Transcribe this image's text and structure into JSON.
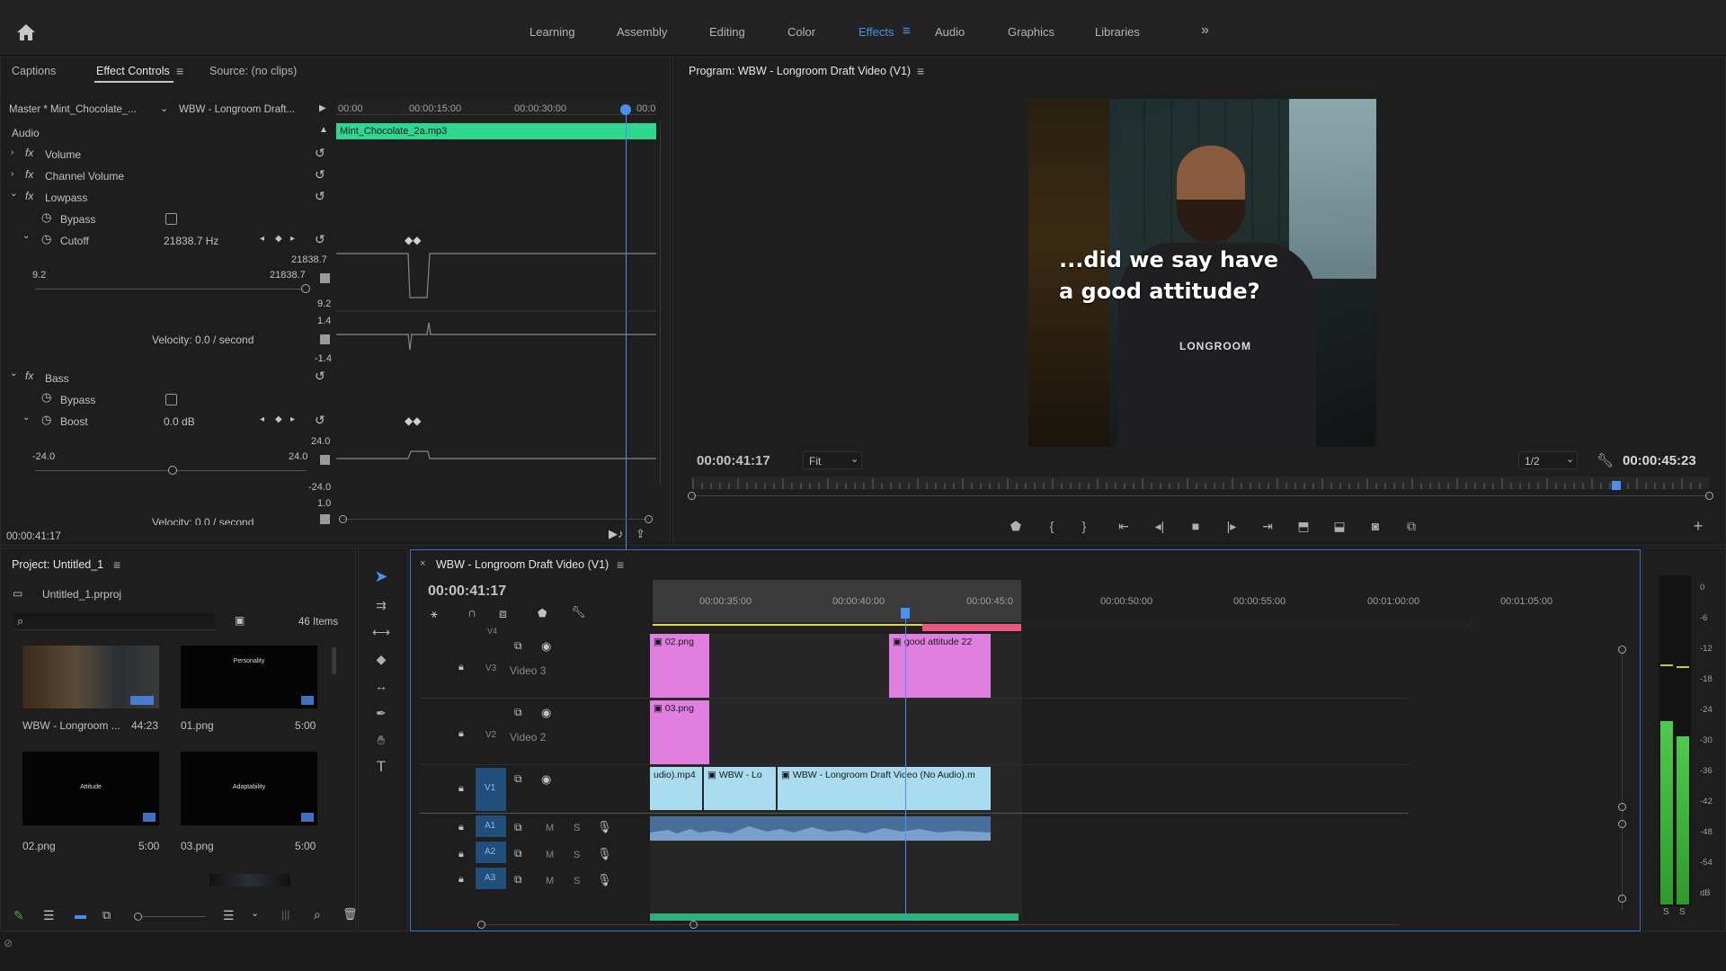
{
  "workspaces": {
    "items": [
      "Learning",
      "Assembly",
      "Editing",
      "Color",
      "Effects",
      "Audio",
      "Graphics",
      "Libraries"
    ],
    "active": "Effects",
    "more": "»"
  },
  "effect_panel": {
    "tabs": [
      "Captions",
      "Effect Controls",
      "Source: (no clips)"
    ],
    "master": "Master * Mint_Chocolate_...",
    "sequence": "WBW - Longroom Draft...",
    "ruler": [
      "00:00",
      "00:00:15:00",
      "00:00:30:00",
      "00:0"
    ],
    "clip_name": "Mint_Chocolate_2a.mp3",
    "section": "Audio",
    "volume": "Volume",
    "channel_volume": "Channel Volume",
    "lowpass": "Lowpass",
    "bypass": "Bypass",
    "cutoff": "Cutoff",
    "cutoff_value": "21838.7 Hz",
    "cutoff_max": "21838.7",
    "cutoff_min_left": "9.2",
    "cutoff_max_right": "21838.7",
    "cutoff_min": "9.2",
    "vel_top": "1.4",
    "velocity": "Velocity: 0.0 / second",
    "vel_bottom": "-1.4",
    "bass": "Bass",
    "bypass2": "Bypass",
    "boost": "Boost",
    "boost_value": "0.0 dB",
    "boost_max": "24.0",
    "boost_min_left": "-24.0",
    "boost_max_right": "24.0",
    "boost_min": "-24.0",
    "boost_vel": "1.0",
    "velocity2": "Velocity: 0.0 / second",
    "timecode": "00:00:41:17"
  },
  "program": {
    "title": "Program: WBW - Longroom Draft Video (V1)",
    "caption_line1": "...did we say have",
    "caption_line2": "a good attitude?",
    "apron_text": "LONGROOM",
    "timecode": "00:00:41:17",
    "fit": "Fit",
    "resolution": "1/2",
    "duration": "00:00:45:23"
  },
  "project": {
    "title": "Project: Untitled_1",
    "file": "Untitled_1.prproj",
    "count": "46 Items",
    "search_placeholder": "",
    "items": [
      {
        "name": "WBW - Longroom ...",
        "duration": "44:23",
        "thumb_text": ""
      },
      {
        "name": "01.png",
        "duration": "5:00",
        "thumb_text": "Personality"
      },
      {
        "name": "02.png",
        "duration": "5:00",
        "thumb_text": "Attitude"
      },
      {
        "name": "03.png",
        "duration": "5:00",
        "thumb_text": "Adaptability"
      }
    ]
  },
  "timeline": {
    "title": "WBW - Longroom Draft Video (V1)",
    "timecode": "00:00:41:17",
    "ruler": [
      "00:00:35:00",
      "00:00:40:00",
      "00:00:45:0",
      "00:00:50:00",
      "00:00:55:00",
      "00:01:00:00",
      "00:01:05:00"
    ],
    "tracks": {
      "v4": "V4",
      "v3": "V3",
      "v3_name": "Video 3",
      "v2": "V2",
      "v2_name": "Video 2",
      "v1": "V1",
      "a1": "A1",
      "a2": "A2",
      "a3": "A3",
      "m": "M",
      "s": "S"
    },
    "clips": {
      "v3_a": "02.png",
      "v3_b": "good attitude 22",
      "v2_a": "03.png",
      "v1_a": "udio).mp4",
      "v1_b": "WBW - Lo",
      "v1_c": "WBW - Longroom Draft Video (No Audio).m"
    }
  },
  "meter": {
    "scale": [
      "0",
      "-6",
      "-12",
      "-18",
      "-24",
      "-30",
      "-36",
      "-42",
      "-48",
      "-54",
      "dB"
    ],
    "solo_left": "S",
    "solo_right": "S",
    "level_left": 0.6,
    "level_right": 0.55
  },
  "colors": {
    "accent": "#4d8ff0",
    "clip_green": "#2fd68f",
    "clip_pink": "#e07fe0",
    "clip_blue": "#a9dcef",
    "audio_clip": "#4a6e9c",
    "render_red": "#e8577c",
    "meter_green": "#3aaf3a"
  }
}
